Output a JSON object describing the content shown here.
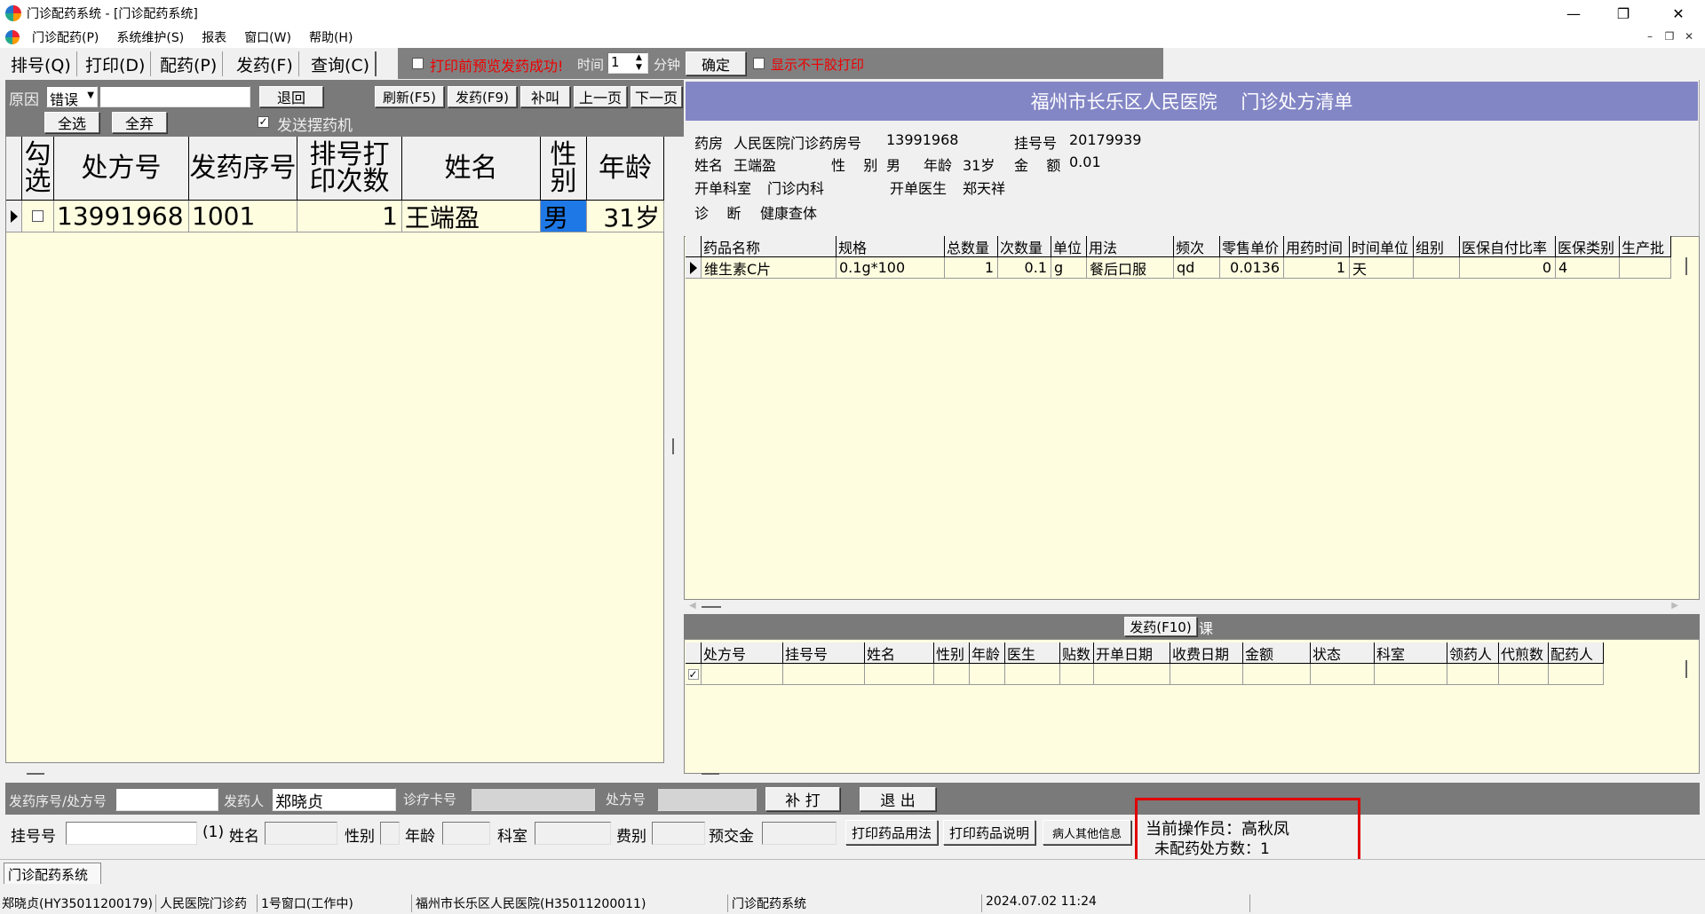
{
  "window": {
    "title": "门诊配药系统 - [门诊配药系统]",
    "minimize": "—",
    "restore": "❐",
    "close": "✕"
  },
  "menu": [
    "门诊配药(P)",
    "系统维护(S)",
    "报表",
    "窗口(W)",
    "帮助(H)"
  ],
  "toolbar": {
    "buttons": [
      "排号(Q)",
      "打印(D)",
      "配药(P)",
      "发药(F)",
      "查询(C)"
    ],
    "preview_checkbox": "打印前预览发药成功!",
    "time_label": "时间",
    "minutes_value": "1",
    "minutes_unit": "分钟",
    "confirm": "确定",
    "no_dry_print": "显示不干胶打印"
  },
  "left": {
    "reason_label": "原因",
    "reason_value": "错误",
    "reason_text": "",
    "return_btn": "退回",
    "refresh_btn": "刷新(F5)",
    "dispense_btn": "发药(F9)",
    "call_btn": "补叫",
    "prev_btn": "上一页",
    "next_btn": "下一页",
    "select_all": "全选",
    "deselect_all": "全弃",
    "send_machine": "发送摆药机",
    "columns": [
      "勾选",
      "处方号",
      "发药序号",
      "排号打印次数",
      "姓名",
      "性别",
      "年龄"
    ],
    "rows": [
      {
        "check": false,
        "rx": "13991968",
        "seq": "1001",
        "prints": "1",
        "name": "王端盈",
        "gender": "男",
        "age": "31岁"
      }
    ]
  },
  "right": {
    "header": "福州市长乐区人民医院    门诊处方清单",
    "pharmacy_label": "药房",
    "pharmacy_value": "人民医院门诊药房号",
    "pharmacy_no": "13991968",
    "reg_label": "挂号号",
    "reg_value": "20179939",
    "name_label": "姓名",
    "name_value": "王端盈",
    "gender_label": "性    别",
    "gender_value": "男",
    "age_label": "年龄",
    "age_value": "31岁",
    "amount_label": "金    额",
    "amount_value": "0.01",
    "dept_label": "开单科室",
    "dept_value": "门诊内科",
    "doctor_label": "开单医生",
    "doctor_value": "郑天祥",
    "diag_label": "诊    断",
    "diag_value": "健康查体",
    "drug_columns": [
      "药品名称",
      "规格",
      "总数量",
      "次数量",
      "单位",
      "用法",
      "频次",
      "零售单价",
      "用药时间",
      "时间单位",
      "组别",
      "医保自付比率",
      "医保类别",
      "生产批"
    ],
    "drug_rows": [
      [
        "维生素C片",
        "0.1g*100",
        "1",
        "0.1",
        "g",
        "餐后口服",
        "qd",
        "0.0136",
        "1",
        "天",
        "",
        "0",
        "4",
        ""
      ]
    ],
    "dispense_tab": "发药(F10)",
    "dispense_tab_suffix": "课",
    "disp_columns": [
      "处方号",
      "挂号号",
      "姓名",
      "性别",
      "年龄",
      "医生",
      "贴数",
      "开单日期",
      "收费日期",
      "金额",
      "状态",
      "科室",
      "领药人",
      "代煎数",
      "配药人"
    ]
  },
  "bottom1": {
    "seq_label": "发药序号/处方号",
    "seq_value": "",
    "dispenser_label": "发药人",
    "dispenser_value": "郑晓贞",
    "card_label": "诊疗卡号",
    "rx_label": "处方号",
    "reprint": "补 打",
    "exit": "退 出"
  },
  "bottom2": {
    "reg_label": "挂号号",
    "paren": "(1)",
    "name_label": "姓名",
    "gender_label": "性别",
    "age_label": "年龄",
    "dept_label": "科室",
    "fee_label": "费别",
    "deposit_label": "预交金",
    "print_usage": "打印药品用法",
    "print_desc": "打印药品说明",
    "other_info": "病人其他信息",
    "operator": "当前操作员：高秋凤",
    "pending": "未配药处方数：1"
  },
  "tab": "门诊配药系统",
  "status": [
    "郑晓贞(HY35011200179)",
    "人民医院门诊药",
    "1号窗口(工作中)",
    "福州市长乐区人民医院(H35011200011)",
    "门诊配药系统",
    "2024.07.02 11:24"
  ],
  "colors": {
    "header_purple": "#8386c5",
    "grid_yellow": "#fffde0",
    "highlight_red": "#e00000",
    "gender_blue": "#1e78e6"
  }
}
